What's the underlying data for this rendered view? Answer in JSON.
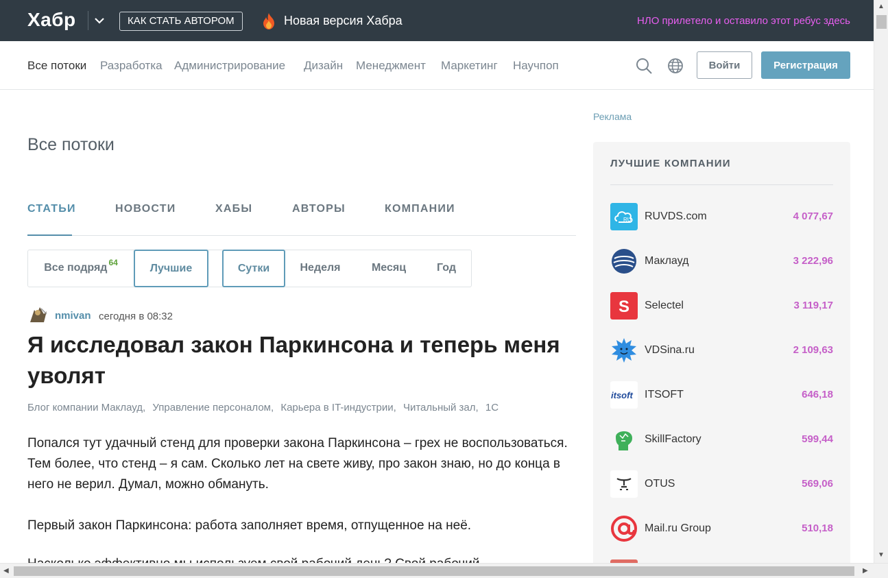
{
  "topbar": {
    "logo": "Хабр",
    "author_button": "КАК СТАТЬ АВТОРОМ",
    "new_version": "Новая версия Хабра",
    "ufo_link": "НЛО прилетело и оставило этот ребус здесь"
  },
  "nav": {
    "items": [
      "Все потоки",
      "Разработка",
      "Администрирование",
      "Дизайн",
      "Менеджмент",
      "Маркетинг",
      "Научпоп"
    ],
    "login": "Войти",
    "register": "Регистрация"
  },
  "page": {
    "title": "Все потоки",
    "tabs": [
      "СТАТЬИ",
      "НОВОСТИ",
      "ХАБЫ",
      "АВТОРЫ",
      "КОМПАНИИ"
    ],
    "filters": {
      "all_label": "Все подряд",
      "all_count": "64",
      "best": "Лучшие",
      "periods": [
        "Сутки",
        "Неделя",
        "Месяц",
        "Год"
      ]
    }
  },
  "post": {
    "author": "nmivan",
    "time": "сегодня в 08:32",
    "title": "Я исследовал закон Паркинсона и теперь меня уволят",
    "hubs": [
      "Блог компании Маклауд,",
      "Управление персоналом,",
      "Карьера в IT-индустрии,",
      "Читальный зал,",
      "1С"
    ],
    "paragraph1": "Попался тут удачный стенд для проверки закона Паркинсона – грех не воспользоваться. Тем более, что стенд – я сам. Сколько лет на свете живу, про закон знаю, но до конца в него не верил. Думал, можно обмануть.",
    "paragraph2": "Первый закон Паркинсона: работа заполняет время, отпущенное на неё.",
    "paragraph3": "Насколько эффективно мы используем свой рабочий день? Свой рабочий"
  },
  "sidebar": {
    "ad_label": "Реклама",
    "companies_title": "ЛУЧШИЕ КОМПАНИИ",
    "companies": [
      {
        "name": "RUVDS.com",
        "rating": "4 077,67",
        "logo_text": "RU",
        "color": "#2fb5e6"
      },
      {
        "name": "Маклауд",
        "rating": "3 222,96",
        "logo_text": "",
        "color": "#2a4f8a"
      },
      {
        "name": "Selectel",
        "rating": "3 119,17",
        "logo_text": "S",
        "color": "#e8363e"
      },
      {
        "name": "VDSina.ru",
        "rating": "2 109,63",
        "logo_text": "",
        "color": "#2f8de0"
      },
      {
        "name": "ITSOFT",
        "rating": "646,18",
        "logo_text": "itsoft",
        "color": "#1f4a9a"
      },
      {
        "name": "SkillFactory",
        "rating": "599,44",
        "logo_text": "",
        "color": "#3fb05a"
      },
      {
        "name": "OTUS",
        "rating": "569,06",
        "logo_text": "",
        "color": "#333333"
      },
      {
        "name": "Mail.ru Group",
        "rating": "510,18",
        "logo_text": "@",
        "color": "#e8363e"
      }
    ]
  },
  "colors": {
    "topbar": "#303b44",
    "accent": "#548eaa",
    "register": "#65a3be",
    "rating": "#c55fc8",
    "ufo": "#e85ef0"
  }
}
